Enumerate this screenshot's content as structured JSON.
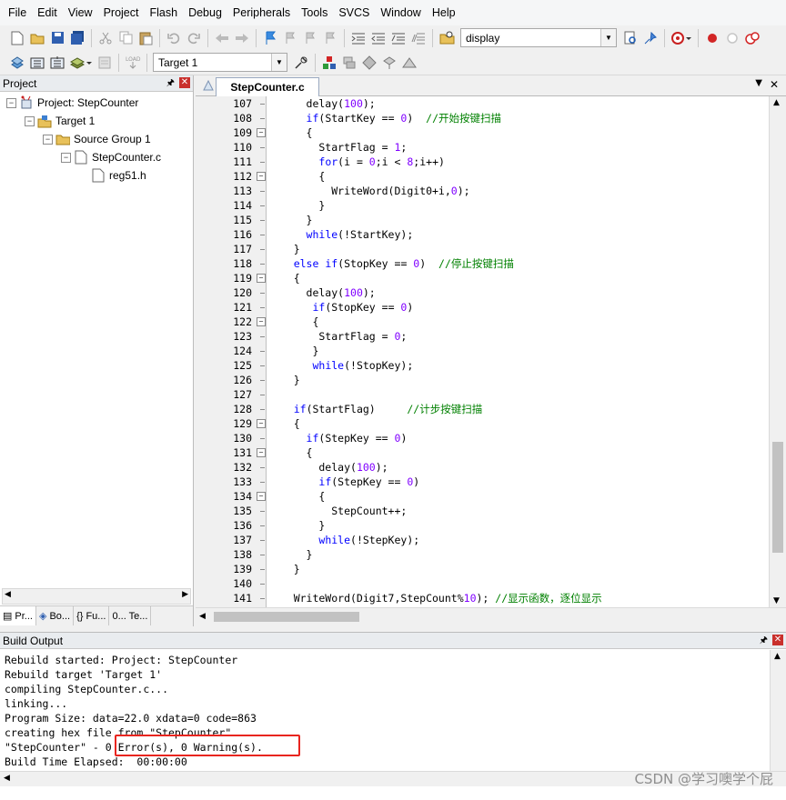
{
  "menu": [
    "File",
    "Edit",
    "View",
    "Project",
    "Flash",
    "Debug",
    "Peripherals",
    "Tools",
    "SVCS",
    "Window",
    "Help"
  ],
  "toolbar": {
    "find_value": "display",
    "target_value": "Target 1"
  },
  "project_pane": {
    "title": "Project",
    "tree": {
      "project": "Project: StepCounter",
      "target": "Target 1",
      "group": "Source Group 1",
      "file": "StepCounter.c",
      "include": "reg51.h"
    },
    "tabs": [
      "Pr...",
      "Bo...",
      "{} Fu...",
      "0... Te..."
    ]
  },
  "editor": {
    "tab_label": "StepCounter.c",
    "lines": [
      {
        "n": "107",
        "code": "      delay(100);"
      },
      {
        "n": "108",
        "code": "      if(StartKey == 0)  //开始按键扫描"
      },
      {
        "n": "109",
        "code": "      {"
      },
      {
        "n": "110",
        "code": "        StartFlag = 1;"
      },
      {
        "n": "111",
        "code": "        for(i = 0;i < 8;i++)"
      },
      {
        "n": "112",
        "code": "        {"
      },
      {
        "n": "113",
        "code": "          WriteWord(Digit0+i,0);"
      },
      {
        "n": "114",
        "code": "        }"
      },
      {
        "n": "115",
        "code": "      }"
      },
      {
        "n": "116",
        "code": "      while(!StartKey);"
      },
      {
        "n": "117",
        "code": "    }"
      },
      {
        "n": "118",
        "code": "    else if(StopKey == 0)  //停止按键扫描"
      },
      {
        "n": "119",
        "code": "    {"
      },
      {
        "n": "120",
        "code": "      delay(100);"
      },
      {
        "n": "121",
        "code": "       if(StopKey == 0)"
      },
      {
        "n": "122",
        "code": "       {"
      },
      {
        "n": "123",
        "code": "        StartFlag = 0;"
      },
      {
        "n": "124",
        "code": "       }"
      },
      {
        "n": "125",
        "code": "       while(!StopKey);"
      },
      {
        "n": "126",
        "code": "    }"
      },
      {
        "n": "127",
        "code": ""
      },
      {
        "n": "128",
        "code": "    if(StartFlag)     //计步按键扫描"
      },
      {
        "n": "129",
        "code": "    {"
      },
      {
        "n": "130",
        "code": "      if(StepKey == 0)"
      },
      {
        "n": "131",
        "code": "      {"
      },
      {
        "n": "132",
        "code": "        delay(100);"
      },
      {
        "n": "133",
        "code": "        if(StepKey == 0)"
      },
      {
        "n": "134",
        "code": "        {"
      },
      {
        "n": "135",
        "code": "          StepCount++;"
      },
      {
        "n": "136",
        "code": "        }"
      },
      {
        "n": "137",
        "code": "        while(!StepKey);"
      },
      {
        "n": "138",
        "code": "      }"
      },
      {
        "n": "139",
        "code": "    }"
      },
      {
        "n": "140",
        "code": ""
      },
      {
        "n": "141",
        "code": "    WriteWord(Digit7,StepCount%10); //显示函数，逐位显示"
      }
    ]
  },
  "build_output": {
    "title": "Build Output",
    "lines": [
      "Rebuild started: Project: StepCounter",
      "Rebuild target 'Target 1'",
      "compiling StepCounter.c...",
      "linking...",
      "Program Size: data=22.0 xdata=0 code=863",
      "creating hex file from \"StepCounter\"...",
      "\"StepCounter\" - 0 Error(s), 0 Warning(s).",
      "Build Time Elapsed:  00:00:00"
    ],
    "watermark": "CSDN @学习噢学个屁"
  }
}
